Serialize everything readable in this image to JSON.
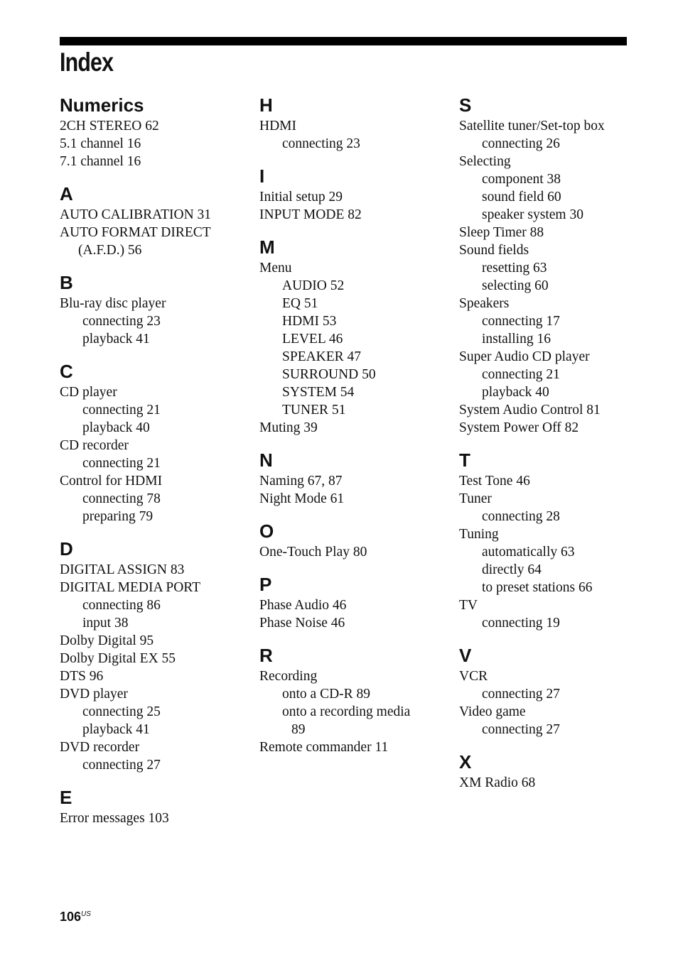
{
  "page": {
    "title": "Index",
    "page_number": "106",
    "page_suffix": "US"
  },
  "columns": [
    [
      {
        "heading": "Numerics",
        "entries": [
          {
            "text": "2CH STEREO  62",
            "level": 0
          },
          {
            "text": "5.1 channel  16",
            "level": 0
          },
          {
            "text": "7.1 channel  16",
            "level": 0
          }
        ]
      },
      {
        "heading": "A",
        "entries": [
          {
            "text": "AUTO CALIBRATION  31",
            "level": 0
          },
          {
            "text": "AUTO FORMAT DIRECT",
            "level": 0
          },
          {
            "text": "(A.F.D.)  56",
            "level": "cont"
          }
        ]
      },
      {
        "heading": "B",
        "entries": [
          {
            "text": "Blu-ray disc player",
            "level": 0
          },
          {
            "text": "connecting  23",
            "level": 1
          },
          {
            "text": "playback  41",
            "level": 1
          }
        ]
      },
      {
        "heading": "C",
        "entries": [
          {
            "text": "CD player",
            "level": 0
          },
          {
            "text": "connecting  21",
            "level": 1
          },
          {
            "text": "playback  40",
            "level": 1
          },
          {
            "text": "CD recorder",
            "level": 0
          },
          {
            "text": "connecting  21",
            "level": 1
          },
          {
            "text": "Control for HDMI",
            "level": 0
          },
          {
            "text": "connecting  78",
            "level": 1
          },
          {
            "text": "preparing  79",
            "level": 1
          }
        ]
      },
      {
        "heading": "D",
        "entries": [
          {
            "text": "DIGITAL ASSIGN  83",
            "level": 0
          },
          {
            "text": "DIGITAL MEDIA PORT",
            "level": 0
          },
          {
            "text": "connecting  86",
            "level": 1
          },
          {
            "text": "input  38",
            "level": 1
          },
          {
            "text": "Dolby Digital  95",
            "level": 0
          },
          {
            "text": "Dolby Digital EX  55",
            "level": 0
          },
          {
            "text": "DTS  96",
            "level": 0
          },
          {
            "text": "DVD player",
            "level": 0
          },
          {
            "text": "connecting  25",
            "level": 1
          },
          {
            "text": "playback  41",
            "level": 1
          },
          {
            "text": "DVD recorder",
            "level": 0
          },
          {
            "text": "connecting  27",
            "level": 1
          }
        ]
      },
      {
        "heading": "E",
        "entries": [
          {
            "text": "Error messages  103",
            "level": 0
          }
        ]
      }
    ],
    [
      {
        "heading": "H",
        "entries": [
          {
            "text": "HDMI",
            "level": 0
          },
          {
            "text": "connecting  23",
            "level": 1
          }
        ]
      },
      {
        "heading": "I",
        "entries": [
          {
            "text": "Initial setup  29",
            "level": 0
          },
          {
            "text": "INPUT MODE  82",
            "level": 0
          }
        ]
      },
      {
        "heading": "M",
        "entries": [
          {
            "text": "Menu",
            "level": 0
          },
          {
            "text": "AUDIO  52",
            "level": 1
          },
          {
            "text": "EQ  51",
            "level": 1
          },
          {
            "text": "HDMI  53",
            "level": 1
          },
          {
            "text": "LEVEL  46",
            "level": 1
          },
          {
            "text": "SPEAKER  47",
            "level": 1
          },
          {
            "text": "SURROUND  50",
            "level": 1
          },
          {
            "text": "SYSTEM  54",
            "level": 1
          },
          {
            "text": "TUNER  51",
            "level": 1
          },
          {
            "text": "Muting  39",
            "level": 0
          }
        ]
      },
      {
        "heading": "N",
        "entries": [
          {
            "text": "Naming  67, 87",
            "level": 0
          },
          {
            "text": "Night Mode  61",
            "level": 0
          }
        ]
      },
      {
        "heading": "O",
        "entries": [
          {
            "text": "One-Touch Play  80",
            "level": 0
          }
        ]
      },
      {
        "heading": "P",
        "entries": [
          {
            "text": "Phase Audio  46",
            "level": 0
          },
          {
            "text": "Phase Noise  46",
            "level": 0
          }
        ]
      },
      {
        "heading": "R",
        "entries": [
          {
            "text": "Recording",
            "level": 0
          },
          {
            "text": "onto a CD-R  89",
            "level": 1
          },
          {
            "text": "onto a recording media",
            "level": 1
          },
          {
            "text": "89",
            "level": "cont2"
          },
          {
            "text": "Remote commander  11",
            "level": 0
          }
        ]
      }
    ],
    [
      {
        "heading": "S",
        "entries": [
          {
            "text": "Satellite tuner/Set-top box",
            "level": 0
          },
          {
            "text": "connecting  26",
            "level": 1
          },
          {
            "text": "Selecting",
            "level": 0
          },
          {
            "text": "component  38",
            "level": 1
          },
          {
            "text": "sound field  60",
            "level": 1
          },
          {
            "text": "speaker system  30",
            "level": 1
          },
          {
            "text": "Sleep Timer  88",
            "level": 0
          },
          {
            "text": "Sound fields",
            "level": 0
          },
          {
            "text": "resetting  63",
            "level": 1
          },
          {
            "text": "selecting  60",
            "level": 1
          },
          {
            "text": "Speakers",
            "level": 0
          },
          {
            "text": "connecting  17",
            "level": 1
          },
          {
            "text": "installing  16",
            "level": 1
          },
          {
            "text": "Super Audio CD player",
            "level": 0
          },
          {
            "text": "connecting  21",
            "level": 1
          },
          {
            "text": "playback  40",
            "level": 1
          },
          {
            "text": "System Audio Control  81",
            "level": 0
          },
          {
            "text": "System Power Off  82",
            "level": 0
          }
        ]
      },
      {
        "heading": "T",
        "entries": [
          {
            "text": "Test Tone  46",
            "level": 0
          },
          {
            "text": "Tuner",
            "level": 0
          },
          {
            "text": "connecting  28",
            "level": 1
          },
          {
            "text": "Tuning",
            "level": 0
          },
          {
            "text": "automatically  63",
            "level": 1
          },
          {
            "text": "directly  64",
            "level": 1
          },
          {
            "text": "to preset stations  66",
            "level": 1
          },
          {
            "text": "TV",
            "level": 0
          },
          {
            "text": "connecting  19",
            "level": 1
          }
        ]
      },
      {
        "heading": "V",
        "entries": [
          {
            "text": "VCR",
            "level": 0
          },
          {
            "text": "connecting  27",
            "level": 1
          },
          {
            "text": "Video game",
            "level": 0
          },
          {
            "text": "connecting  27",
            "level": 1
          }
        ]
      },
      {
        "heading": "X",
        "entries": [
          {
            "text": "XM Radio  68",
            "level": 0
          }
        ]
      }
    ]
  ]
}
